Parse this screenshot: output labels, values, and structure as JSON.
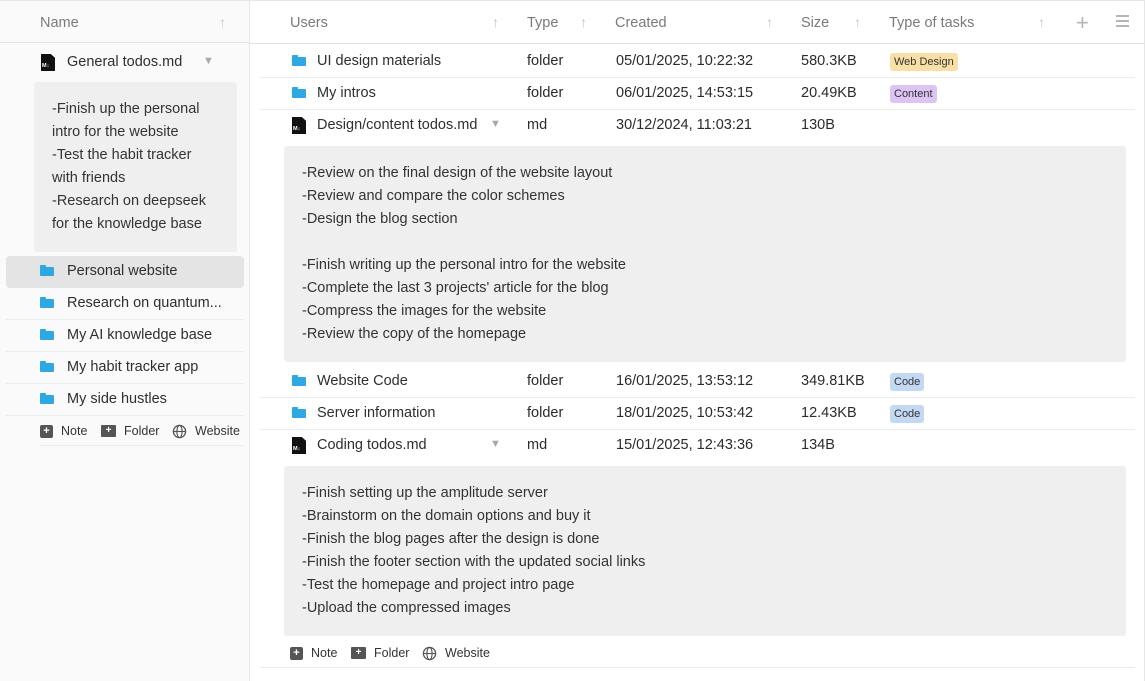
{
  "sidebar": {
    "header": {
      "label": "Name",
      "sort_glyph": "↑"
    },
    "note_file": {
      "label": "General todos.md",
      "icon": "markdown-file-icon"
    },
    "note_content": "-Finish up the personal\nintro for the website\n-Test the habit tracker\nwith friends\n-Research on deepseek\nfor the knowledge base",
    "folders": [
      {
        "label": "Personal website",
        "selected": true
      },
      {
        "label": "Research on quantum..."
      },
      {
        "label": "My AI knowledge base"
      },
      {
        "label": "My habit tracker app"
      },
      {
        "label": "My side hustles"
      }
    ],
    "add_bar": {
      "note": "Note",
      "folder": "Folder",
      "website": "Website"
    }
  },
  "table": {
    "columns": {
      "users": "Users",
      "type": "Type",
      "created": "Created",
      "size": "Size",
      "tasks": "Type of tasks"
    },
    "sort_glyph": "↑",
    "add_column_glyph": "+",
    "rows": [
      {
        "name": "UI design materials",
        "type": "folder",
        "created": "05/01/2025, 10:22:32",
        "size": "580.3KB",
        "tag": "Web Design",
        "tag_color": "#f7dfa6"
      },
      {
        "name": "My intros",
        "type": "folder",
        "created": "06/01/2025, 14:53:15",
        "size": "20.49KB",
        "tag": "Content",
        "tag_color": "#dcc4f5"
      },
      {
        "name": "Design/content todos.md",
        "type": "md",
        "created": "30/12/2024, 11:03:21",
        "size": "130B",
        "tag": ""
      },
      {
        "name": "Website Code",
        "type": "folder",
        "created": "16/01/2025, 13:53:12",
        "size": "349.81KB",
        "tag": "Code",
        "tag_color": "#c3d8f3"
      },
      {
        "name": "Server information",
        "type": "folder",
        "created": "18/01/2025, 10:53:42",
        "size": "12.43KB",
        "tag": "Code",
        "tag_color": "#c3d8f3"
      },
      {
        "name": "Coding todos.md",
        "type": "md",
        "created": "15/01/2025, 12:43:36",
        "size": "134B",
        "tag": ""
      }
    ],
    "design_note": "-Review on the final design of the website layout\n-Review and compare the color schemes\n-Design the blog section\n\n-Finish writing up the personal intro for the website\n-Complete the last 3 projects' article for the blog\n-Compress the images for the website\n-Review the copy of the homepage",
    "coding_note": "-Finish setting up the amplitude server\n-Brainstorm on the domain options and buy it\n-Finish the blog pages after the design is done\n-Finish the footer section with the updated social links\n-Test the homepage and project intro page\n-Upload the compressed images",
    "add_bar": {
      "note": "Note",
      "folder": "Folder",
      "website": "Website"
    }
  },
  "glyphs": {
    "caret": "▼",
    "plus_square": "+",
    "md_label": "M↓"
  }
}
